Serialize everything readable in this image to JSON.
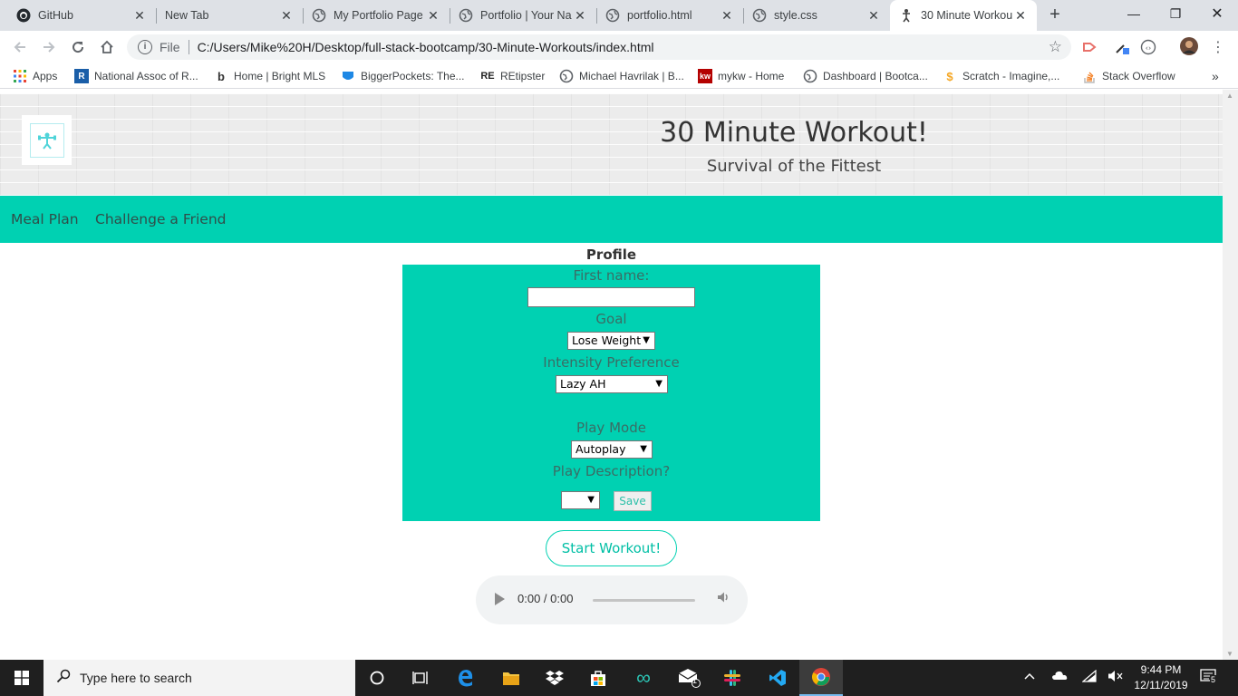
{
  "browser": {
    "tabs": [
      {
        "title": "GitHub",
        "icon": "github-icon"
      },
      {
        "title": "New Tab",
        "icon": "none"
      },
      {
        "title": "My Portfolio Page",
        "icon": "globe-icon"
      },
      {
        "title": "Portfolio | Your Na",
        "icon": "globe-icon"
      },
      {
        "title": "portfolio.html",
        "icon": "globe-icon"
      },
      {
        "title": "style.css",
        "icon": "globe-icon"
      },
      {
        "title": "30 Minute Workou",
        "icon": "workout-favicon",
        "active": true
      }
    ],
    "new_tab_glyph": "+",
    "window_controls": {
      "minimize": "—",
      "restore": "❐",
      "close": "✕"
    },
    "omnibox": {
      "scheme_label": "File",
      "url": "C:/Users/Mike%20H/Desktop/full-stack-bootcamp/30-Minute-Workouts/index.html"
    },
    "bookmarks": [
      {
        "label": "Apps",
        "icon": "apps-grid-icon"
      },
      {
        "label": "National Assoc of R...",
        "icon": "nar-icon"
      },
      {
        "label": "Home | Bright MLS",
        "icon": "bright-mls-icon"
      },
      {
        "label": "BiggerPockets: The...",
        "icon": "biggerpockets-icon"
      },
      {
        "label": "REtipster",
        "icon": "retipster-icon"
      },
      {
        "label": "Michael Havrilak | B...",
        "icon": "globe-icon"
      },
      {
        "label": "mykw - Home",
        "icon": "kw-icon"
      },
      {
        "label": "Dashboard | Bootca...",
        "icon": "globe-icon"
      },
      {
        "label": "Scratch - Imagine,...",
        "icon": "scratch-icon"
      },
      {
        "label": "Stack Overflow",
        "icon": "stackoverflow-icon"
      }
    ],
    "bookmarks_overflow": "»"
  },
  "page": {
    "site_title": "30 Minute Workout!",
    "site_subtitle": "Survival of the Fittest",
    "nav": [
      "Meal Plan",
      "Challenge a Friend"
    ],
    "profile": {
      "heading": "Profile",
      "first_name_label": "First name:",
      "first_name_value": "",
      "goal_label": "Goal",
      "goal_selected": "Lose Weight",
      "intensity_label": "Intensity Preference",
      "intensity_selected": "Lazy AH",
      "play_mode_label": "Play Mode",
      "play_mode_selected": "Autoplay",
      "play_description_label": "Play Description?",
      "play_description_selected": "",
      "save_label": "Save"
    },
    "start_button": "Start Workout!",
    "audio": {
      "time": "0:00 / 0:00",
      "progress": 0
    }
  },
  "taskbar": {
    "search_placeholder": "Type here to search",
    "time": "9:44 PM",
    "date": "12/11/2019",
    "mail_badge": "1",
    "notification_count": "5"
  },
  "colors": {
    "accent": "#00d1b2",
    "tab_strip": "#dee1e6",
    "taskbar": "#1f1f1f"
  }
}
